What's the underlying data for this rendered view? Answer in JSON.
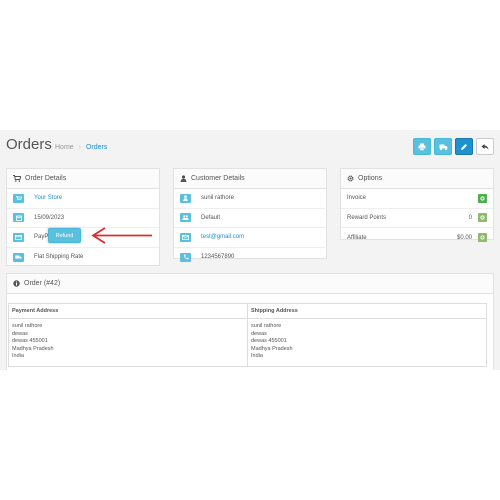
{
  "header": {
    "title": "Orders",
    "breadcrumb": [
      "Home",
      "Orders"
    ]
  },
  "toolbar": {
    "icons": [
      "print-icon",
      "truck-icon",
      "pencil-icon",
      "reply-icon"
    ]
  },
  "order_details": {
    "title": "Order Details",
    "store": "Your Store",
    "date": "15/09/2023",
    "payment_method": "PayPal",
    "refund_label": "Refund",
    "shipping_method": "Flat Shipping Rate"
  },
  "customer_details": {
    "title": "Customer Details",
    "name": "sunil rathore",
    "group": "Default",
    "email": "test@gmail.com",
    "phone": "1234567890"
  },
  "options": {
    "title": "Options",
    "rows": [
      {
        "label": "Invoice",
        "value": ""
      },
      {
        "label": "Reward Points",
        "value": "0"
      },
      {
        "label": "Affiliate",
        "value": "$0.00"
      }
    ]
  },
  "order": {
    "title": "Order (#42)",
    "payment_address_header": "Payment Address",
    "shipping_address_header": "Shipping Address",
    "payment_address": [
      "sunil rathore",
      "dewas",
      "dewas 455001",
      "Madhya Pradesh",
      "India"
    ],
    "shipping_address": [
      "sunil rathore",
      "dewas",
      "dewas 455001",
      "Madhya Pradesh",
      "India"
    ]
  },
  "colors": {
    "info": "#5bc0de",
    "primary": "#1e91cf",
    "success": "#8fbb6c",
    "arrow": "#d9302f"
  }
}
